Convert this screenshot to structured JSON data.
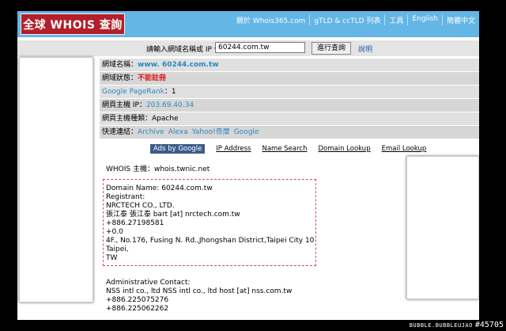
{
  "header": {
    "logo_text": "全球 WHOIS 查詢",
    "nav": [
      "關於 Whois365.com",
      "gTLD & ccTLD 列表",
      "工具",
      "English",
      "簡體中文"
    ]
  },
  "search": {
    "label": "請輸入網域名稱或 IP 位址",
    "value": "60244.com.tw",
    "button": "進行查詢",
    "help": "說明"
  },
  "info": {
    "domain_label": "網域名稱：",
    "domain_value": "www. 60244.com.tw",
    "status_label": "網域狀態：",
    "status_value": "不能註冊",
    "pagerank_label": "Google PageRank",
    "pagerank_value": "：1",
    "ip_label": "網頁主機 IP：",
    "ip_value": "203.69.40.34",
    "server_label": "網頁主機種類：",
    "server_value": "Apache",
    "quick_label": "快速連結：",
    "quick_links": [
      "Archive",
      "Alexa",
      "Yahoo!奇摩",
      "Google"
    ]
  },
  "ads": {
    "label": "Ads by Google",
    "links": [
      "IP Address",
      "Name Search",
      "Domain Lookup",
      "Email Lookup"
    ]
  },
  "whois": {
    "server_line": "WHOIS 主機：whois.twnic.net",
    "record": [
      "Domain Name: 60244.com.tw",
      "Registrant:",
      "NRCTECH CO., LTD.",
      "張江泰 張江泰 bart [at] nrctech.com.tw",
      "+886.27198581",
      "+0.0",
      "4F., No.176, Fusing N. Rd.,Jhongshan District,Taipei City 10",
      "Taipei,",
      "TW"
    ],
    "admin": [
      "Administrative Contact:",
      "NSS intl co., ltd NSS intl co., ltd host [at] nss.com.tw",
      "+886.225075276",
      "+886.225062262"
    ]
  },
  "watermark": {
    "site": "BUBBLE.BUBBLEUJAO",
    "id": "#45705"
  },
  "colors": {
    "header_bg": "#63b6e6",
    "logo_bg": "#b31f2a",
    "status_red": "#d91e1e",
    "link_blue": "#2a8ac0",
    "record_border": "#d44a6a"
  }
}
